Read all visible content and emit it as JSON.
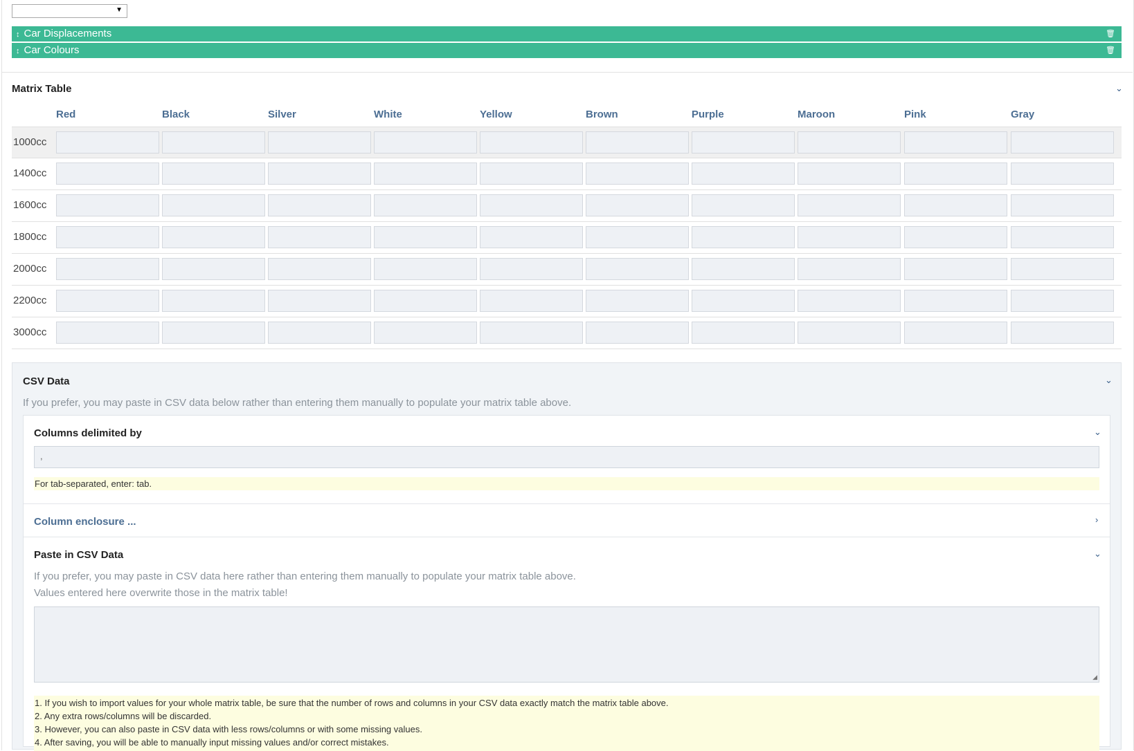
{
  "select": {
    "value": ""
  },
  "bars": [
    {
      "label": "Car Displacements",
      "move_icon": "↕",
      "trash_icon": "🗑"
    },
    {
      "label": "Car Colours",
      "move_icon": "↕",
      "trash_icon": "🗑"
    }
  ],
  "matrix": {
    "title": "Matrix Table",
    "columns": [
      "Red",
      "Black",
      "Silver",
      "White",
      "Yellow",
      "Brown",
      "Purple",
      "Maroon",
      "Pink",
      "Gray"
    ],
    "rows": [
      "1000cc",
      "1400cc",
      "1600cc",
      "1800cc",
      "2000cc",
      "2200cc",
      "3000cc"
    ]
  },
  "csv": {
    "title": "CSV Data",
    "description": "If you prefer, you may paste in CSV data below rather than entering them manually to populate your matrix table above.",
    "delimiter": {
      "title": "Columns delimited by",
      "value": ",",
      "hint": "For tab-separated, enter: tab."
    },
    "enclosure": {
      "title": "Column enclosure ..."
    },
    "paste": {
      "title": "Paste in CSV Data",
      "line1": "If you prefer, you may paste in CSV data here rather than entering them manually to populate your matrix table above.",
      "line2": "Values entered here overwrite those in the matrix table!",
      "notes": [
        "1. If you wish to import values for your whole matrix table, be sure that the number of rows and columns in your CSV data exactly match the matrix table above.",
        "2. Any extra rows/columns will be discarded.",
        "3. However, you can also paste in CSV data with less rows/columns or with some missing values.",
        "4. After saving, you will be able to manually input missing values and/or correct mistakes."
      ]
    }
  },
  "icons": {
    "chevron_down": "⌄",
    "chevron_right": "›",
    "dropdown_arrow": "▼",
    "resize_grip": "◢"
  }
}
